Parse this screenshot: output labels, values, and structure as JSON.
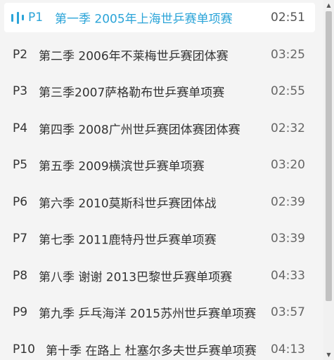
{
  "playlist": {
    "items": [
      {
        "num": "P1",
        "title": "第一季 2005年上海世乒赛单项赛",
        "duration": "02:51",
        "active": true
      },
      {
        "num": "P2",
        "title": "第二季 2006年不莱梅世乒赛团体赛",
        "duration": "03:25",
        "active": false
      },
      {
        "num": "P3",
        "title": "第三季2007萨格勒布世乒赛单项赛",
        "duration": "02:55",
        "active": false
      },
      {
        "num": "P4",
        "title": "第四季 2008广州世乒赛团体赛团体赛",
        "duration": "02:32",
        "active": false
      },
      {
        "num": "P5",
        "title": "第五季 2009横滨世乒赛单项赛",
        "duration": "03:20",
        "active": false
      },
      {
        "num": "P6",
        "title": "第六季 2010莫斯科世乒赛团体战",
        "duration": "02:39",
        "active": false
      },
      {
        "num": "P7",
        "title": "第七季 2011鹿特丹世乒赛单项赛",
        "duration": "03:39",
        "active": false
      },
      {
        "num": "P8",
        "title": "第八季 谢谢 2013巴黎世乒赛单项赛",
        "duration": "04:33",
        "active": false
      },
      {
        "num": "P9",
        "title": "第九季 乒乓海洋 2015苏州世乒赛单项赛",
        "duration": "03:57",
        "active": false
      },
      {
        "num": "P10",
        "title": "第十季 在路上 杜塞尔多夫世乒赛单项赛",
        "duration": "04:13",
        "active": false
      }
    ],
    "accent_color": "#2ba4d8",
    "playing_icon": "playing-bars-icon"
  },
  "scrollbar": {
    "up_icon": "▲",
    "down_icon": "▼"
  }
}
